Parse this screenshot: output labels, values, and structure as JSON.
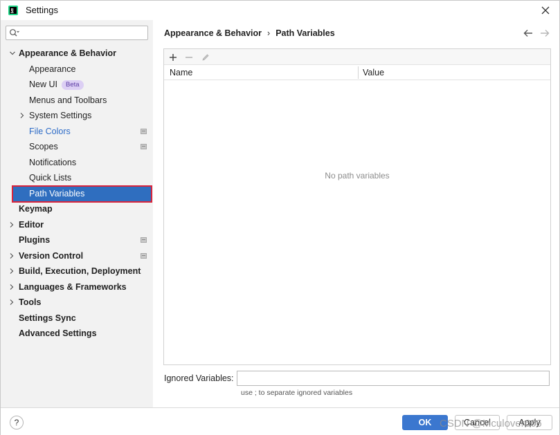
{
  "window": {
    "title": "Settings"
  },
  "sidebar": {
    "search_placeholder": "",
    "items": [
      {
        "label": "Appearance & Behavior",
        "expanded": true
      },
      {
        "label": "Appearance"
      },
      {
        "label": "New UI",
        "badge": "Beta"
      },
      {
        "label": "Menus and Toolbars"
      },
      {
        "label": "System Settings"
      },
      {
        "label": "File Colors"
      },
      {
        "label": "Scopes"
      },
      {
        "label": "Notifications"
      },
      {
        "label": "Quick Lists"
      },
      {
        "label": "Path Variables",
        "selected": true
      },
      {
        "label": "Keymap"
      },
      {
        "label": "Editor"
      },
      {
        "label": "Plugins"
      },
      {
        "label": "Version Control"
      },
      {
        "label": "Build, Execution, Deployment"
      },
      {
        "label": "Languages & Frameworks"
      },
      {
        "label": "Tools"
      },
      {
        "label": "Settings Sync"
      },
      {
        "label": "Advanced Settings"
      }
    ]
  },
  "breadcrumb": {
    "parent": "Appearance & Behavior",
    "separator": "›",
    "current": "Path Variables"
  },
  "table": {
    "columns": [
      "Name",
      "Value"
    ],
    "empty_text": "No path variables"
  },
  "ignored": {
    "label": "Ignored Variables:",
    "value": "",
    "hint": "use ; to separate ignored variables"
  },
  "footer": {
    "help_label": "?",
    "ok_label": "OK",
    "cancel_label": "Cancel",
    "apply_label": "Apply",
    "watermark": "CSDN @Mculover666"
  },
  "colors": {
    "selection": "#2f6ebf",
    "link": "#2d6bc7",
    "primary_button": "#3b77cf",
    "highlight_outline": "#d9243b"
  }
}
